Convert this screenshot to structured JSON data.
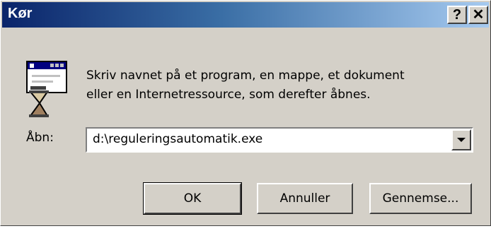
{
  "window": {
    "title": "Kør",
    "help_label": "?",
    "close_label": "✕"
  },
  "dialog": {
    "icon": "run-program-icon",
    "message_line1": "Skriv navnet på et program, en mappe, et dokument",
    "message_line2": "eller en Internetressource, som derefter åbnes.",
    "open_label": "Åbn:",
    "open_value": "d:\\reguleringsautomatik.exe",
    "dropdown_icon": "chevron-down-icon"
  },
  "buttons": {
    "ok": "OK",
    "cancel": "Annuller",
    "browse": "Gennemse..."
  },
  "colors": {
    "titlebar_start": "#0a246a",
    "titlebar_end": "#a6caf0",
    "face": "#d4d0c8"
  }
}
